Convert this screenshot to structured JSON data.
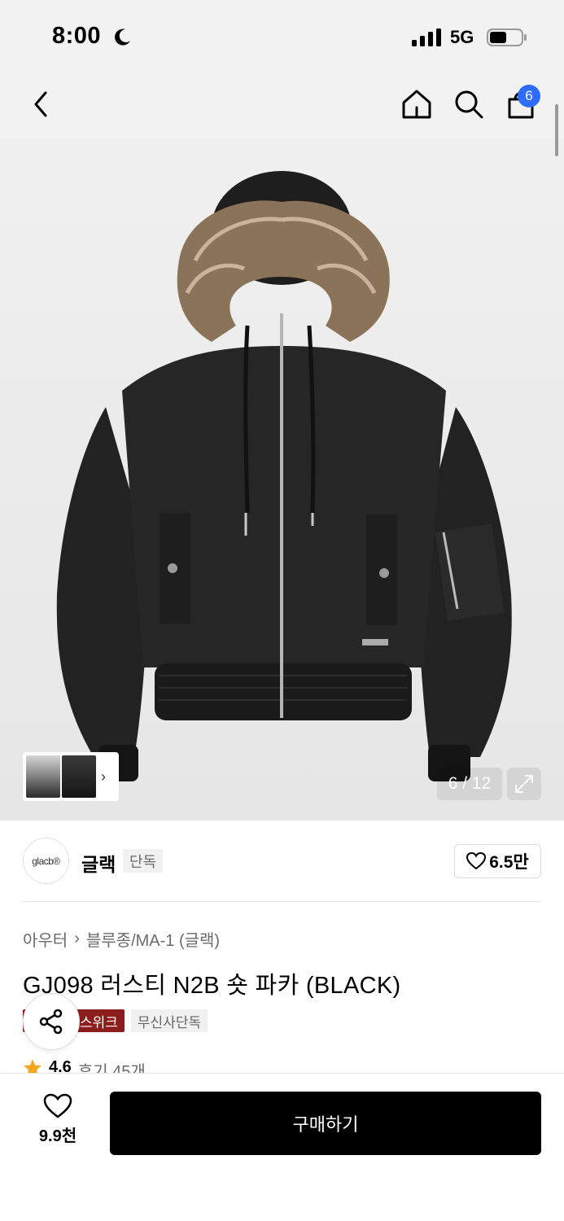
{
  "status_bar": {
    "time": "8:00",
    "network": "5G"
  },
  "nav": {
    "cart_count": "6"
  },
  "gallery": {
    "counter": "6 / 12"
  },
  "brand": {
    "logo_text": "glacb®",
    "name": "글랙",
    "tag": "단독"
  },
  "likes": {
    "count": "6.5만"
  },
  "breadcrumb": {
    "category": "아우터",
    "sub_category": "블루종/MA-1 (글랙)"
  },
  "product": {
    "title": "GJ098 러스티 N2B 숏 파카 (BLACK)",
    "tags": [
      "스위크",
      "무신사단독"
    ],
    "rating": "4.6",
    "review_label": "후기 45개"
  },
  "bottom_bar": {
    "wishlist_count": "9.9천",
    "buy_label": "구매하기"
  },
  "colors": {
    "accent": "#2e6bff",
    "tag_red": "#8c1d1d",
    "star": "#f5a623"
  },
  "icons": [
    "back-icon",
    "home-icon",
    "search-icon",
    "cart-icon",
    "expand-icon",
    "heart-icon",
    "share-icon",
    "star-icon"
  ]
}
